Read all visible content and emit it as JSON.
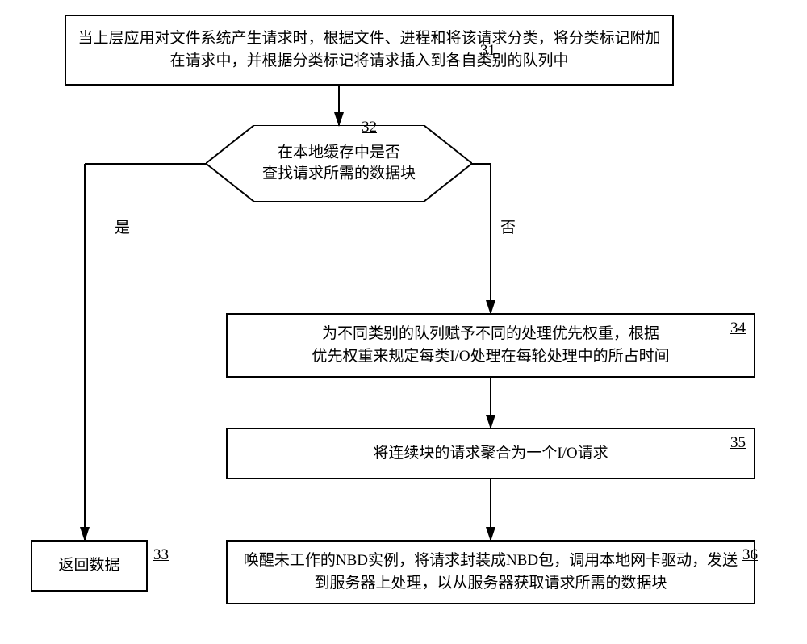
{
  "flowchart": {
    "box31": {
      "text": "当上层应用对文件系统产生请求时，根据文件、进程和将该请求分类，将分类标记附加在请求中，并根据分类标记将请求插入到各自类别的队列中",
      "num": "31"
    },
    "decision32": {
      "text": "在本地缓存中是否\n查找请求所需的数据块",
      "num": "32"
    },
    "box33": {
      "text": "返回数据",
      "num": "33"
    },
    "box34": {
      "text": "为不同类别的队列赋予不同的处理优先权重，根据\n优先权重来规定每类I/O处理在每轮处理中的所占时间",
      "num": "34"
    },
    "box35": {
      "text": "将连续块的请求聚合为一个I/O请求",
      "num": "35"
    },
    "box36": {
      "text": "唤醒未工作的NBD实例，将请求封装成NBD包，调用本地网卡驱动，发送到服务器上处理，以从服务器获取请求所需的数据块",
      "num": "36"
    },
    "labels": {
      "yes": "是",
      "no": "否"
    }
  }
}
